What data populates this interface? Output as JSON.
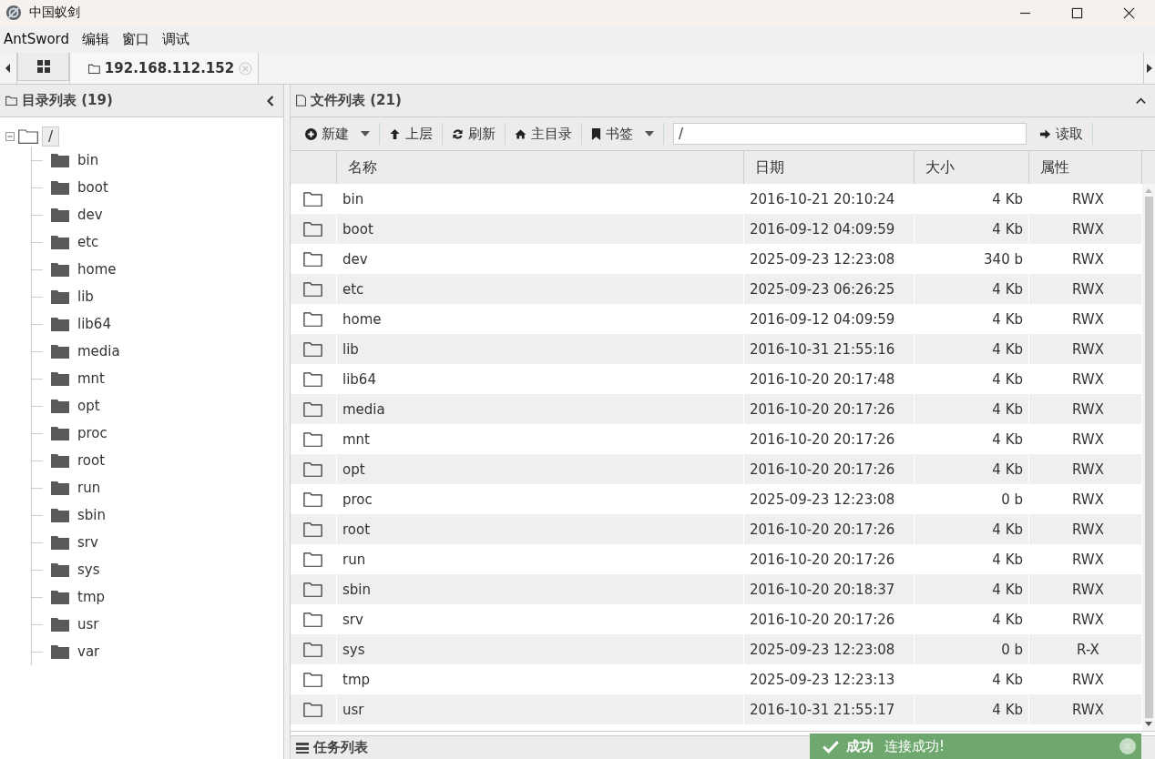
{
  "window": {
    "title": "中国蚁剑"
  },
  "menu": [
    "AntSword",
    "编辑",
    "窗口",
    "调试"
  ],
  "tabs": [
    {
      "kind": "home",
      "selected": false
    },
    {
      "kind": "folder",
      "label": "192.168.112.152",
      "selected": true
    }
  ],
  "dir_panel": {
    "title": "目录列表 (19)",
    "tree": {
      "label": "/",
      "expanded": true,
      "children": [
        {
          "label": "bin"
        },
        {
          "label": "boot"
        },
        {
          "label": "dev"
        },
        {
          "label": "etc"
        },
        {
          "label": "home"
        },
        {
          "label": "lib"
        },
        {
          "label": "lib64"
        },
        {
          "label": "media"
        },
        {
          "label": "mnt"
        },
        {
          "label": "opt"
        },
        {
          "label": "proc"
        },
        {
          "label": "root"
        },
        {
          "label": "run"
        },
        {
          "label": "sbin"
        },
        {
          "label": "srv"
        },
        {
          "label": "sys"
        },
        {
          "label": "tmp"
        },
        {
          "label": "usr"
        },
        {
          "label": "var"
        }
      ]
    }
  },
  "file_panel": {
    "title": "文件列表 (21)",
    "toolbar": [
      {
        "kind": "new",
        "label": "新建",
        "dropdown": true
      },
      {
        "kind": "up",
        "label": "上层",
        "dropdown": false
      },
      {
        "kind": "refresh",
        "label": "刷新",
        "dropdown": false
      },
      {
        "kind": "home",
        "label": "主目录",
        "dropdown": false
      },
      {
        "kind": "bookmark",
        "label": "书签",
        "dropdown": true
      }
    ],
    "path": "/",
    "read_button": "读取",
    "columns": [
      "名称",
      "日期",
      "大小",
      "属性"
    ],
    "rows": [
      [
        "bin",
        "2016-10-21 20:10:24",
        "4 Kb",
        "RWX"
      ],
      [
        "boot",
        "2016-09-12 04:09:59",
        "4 Kb",
        "RWX"
      ],
      [
        "dev",
        "2025-09-23 12:23:08",
        "340 b",
        "RWX"
      ],
      [
        "etc",
        "2025-09-23 06:26:25",
        "4 Kb",
        "RWX"
      ],
      [
        "home",
        "2016-09-12 04:09:59",
        "4 Kb",
        "RWX"
      ],
      [
        "lib",
        "2016-10-31 21:55:16",
        "4 Kb",
        "RWX"
      ],
      [
        "lib64",
        "2016-10-20 20:17:48",
        "4 Kb",
        "RWX"
      ],
      [
        "media",
        "2016-10-20 20:17:26",
        "4 Kb",
        "RWX"
      ],
      [
        "mnt",
        "2016-10-20 20:17:26",
        "4 Kb",
        "RWX"
      ],
      [
        "opt",
        "2016-10-20 20:17:26",
        "4 Kb",
        "RWX"
      ],
      [
        "proc",
        "2025-09-23 12:23:08",
        "0 b",
        "RWX"
      ],
      [
        "root",
        "2016-10-20 20:17:26",
        "4 Kb",
        "RWX"
      ],
      [
        "run",
        "2016-10-20 20:17:26",
        "4 Kb",
        "RWX"
      ],
      [
        "sbin",
        "2016-10-20 20:18:37",
        "4 Kb",
        "RWX"
      ],
      [
        "srv",
        "2016-10-20 20:17:26",
        "4 Kb",
        "RWX"
      ],
      [
        "sys",
        "2025-09-23 12:23:08",
        "0 b",
        "R-X"
      ],
      [
        "tmp",
        "2025-09-23 12:23:13",
        "4 Kb",
        "RWX"
      ],
      [
        "usr",
        "2016-10-31 21:55:17",
        "4 Kb",
        "RWX"
      ]
    ]
  },
  "task_panel": {
    "title": "任务列表"
  },
  "toast": {
    "title": "成功",
    "message": "连接成功!"
  }
}
